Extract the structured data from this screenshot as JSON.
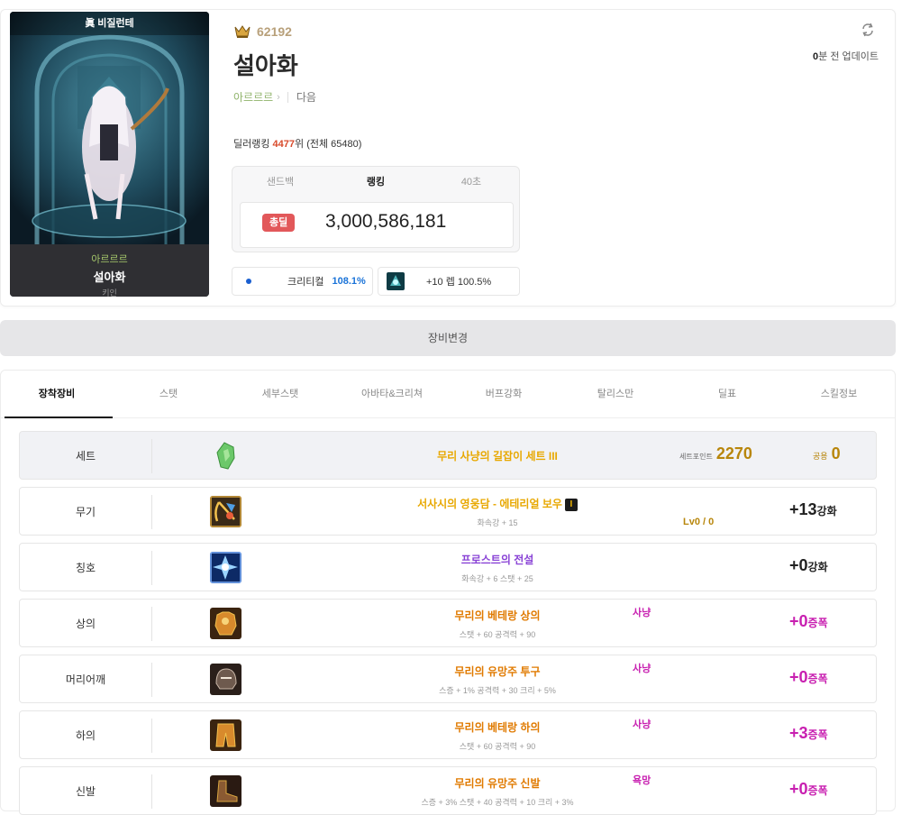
{
  "colors": {
    "legendary": "#e8a800",
    "unique_magenta": "#c81fb0",
    "epic_orange": "#e07a00",
    "rare_purple": "#8a44d6",
    "deal_red": "#e2585a",
    "crit_blue": "#1a73d8"
  },
  "character": {
    "server_banner": "眞 비질런테",
    "adventure": "아르르르",
    "name": "설아화",
    "job": "키인",
    "fame": "62192",
    "links": {
      "adventure": "아르르르",
      "next": "다음"
    },
    "ranking": {
      "prefix": "딜러랭킹 ",
      "rank": "4477",
      "suffix": "위 (전체 65480)"
    },
    "update": {
      "value": "0",
      "label": "분 전 업데이트"
    }
  },
  "rank_box": {
    "tabs": [
      "샌드백",
      "랭킹",
      "40초"
    ],
    "active_tab": "랭킹",
    "badge": "총딜",
    "value": "3,000,586,181"
  },
  "stats": {
    "crit_label": "크리티컬",
    "crit_value": "108.1%",
    "buff_text": "+10 렙 100.5%"
  },
  "equip_change_label": "장비변경",
  "tabs": [
    "장착장비",
    "스탯",
    "세부스탯",
    "아바타&크리쳐",
    "버프강화",
    "탈리스만",
    "딜표",
    "스킬정보"
  ],
  "set_row": {
    "slot": "세트",
    "name": "무리 사냥의 길잡이 세트 III",
    "point_label": "세트포인트",
    "point_value": "2270",
    "gong_label": "공용",
    "gong_value": "0"
  },
  "equipment": [
    {
      "slot": "무기",
      "name": "서사시의 영웅담 - 에테리얼 보우",
      "extra": "I",
      "sub": "화속강 + 15",
      "grade": "",
      "lv": "Lv0 / 0",
      "enhance": "+13",
      "enhance_unit": "강화",
      "name_color": "#e8a800",
      "enh_color": "dark"
    },
    {
      "slot": "칭호",
      "name": "프로스트의 전설",
      "extra": "",
      "sub": "화속강 + 6 스탯 + 25",
      "grade": "",
      "lv": "",
      "enhance": "+0",
      "enhance_unit": "강화",
      "name_color": "#8a44d6",
      "enh_color": "dark"
    },
    {
      "slot": "상의",
      "name": "무리의 베테랑 상의",
      "extra": "",
      "sub": "스탯 + 60 공격력 + 90",
      "grade": "사냥",
      "lv": "",
      "enhance": "+0",
      "enhance_unit": "증폭",
      "name_color": "#e07a00",
      "enh_color": "magenta"
    },
    {
      "slot": "머리어깨",
      "name": "무리의 유망주 투구",
      "extra": "",
      "sub": "스증 + 1% 공격력 + 30 크리 + 5%",
      "grade": "사냥",
      "lv": "",
      "enhance": "+0",
      "enhance_unit": "증폭",
      "name_color": "#e07a00",
      "enh_color": "magenta"
    },
    {
      "slot": "하의",
      "name": "무리의 베테랑 하의",
      "extra": "",
      "sub": "스탯 + 60 공격력 + 90",
      "grade": "사냥",
      "lv": "",
      "enhance": "+3",
      "enhance_unit": "증폭",
      "name_color": "#e07a00",
      "enh_color": "magenta"
    },
    {
      "slot": "신발",
      "name": "무리의 유망주 신발",
      "extra": "",
      "sub": "스증 + 3% 스탯 + 40 공격력 + 10 크리 + 3%",
      "grade": "욕망",
      "lv": "",
      "enhance": "+0",
      "enhance_unit": "증폭",
      "name_color": "#e07a00",
      "enh_color": "magenta"
    }
  ]
}
